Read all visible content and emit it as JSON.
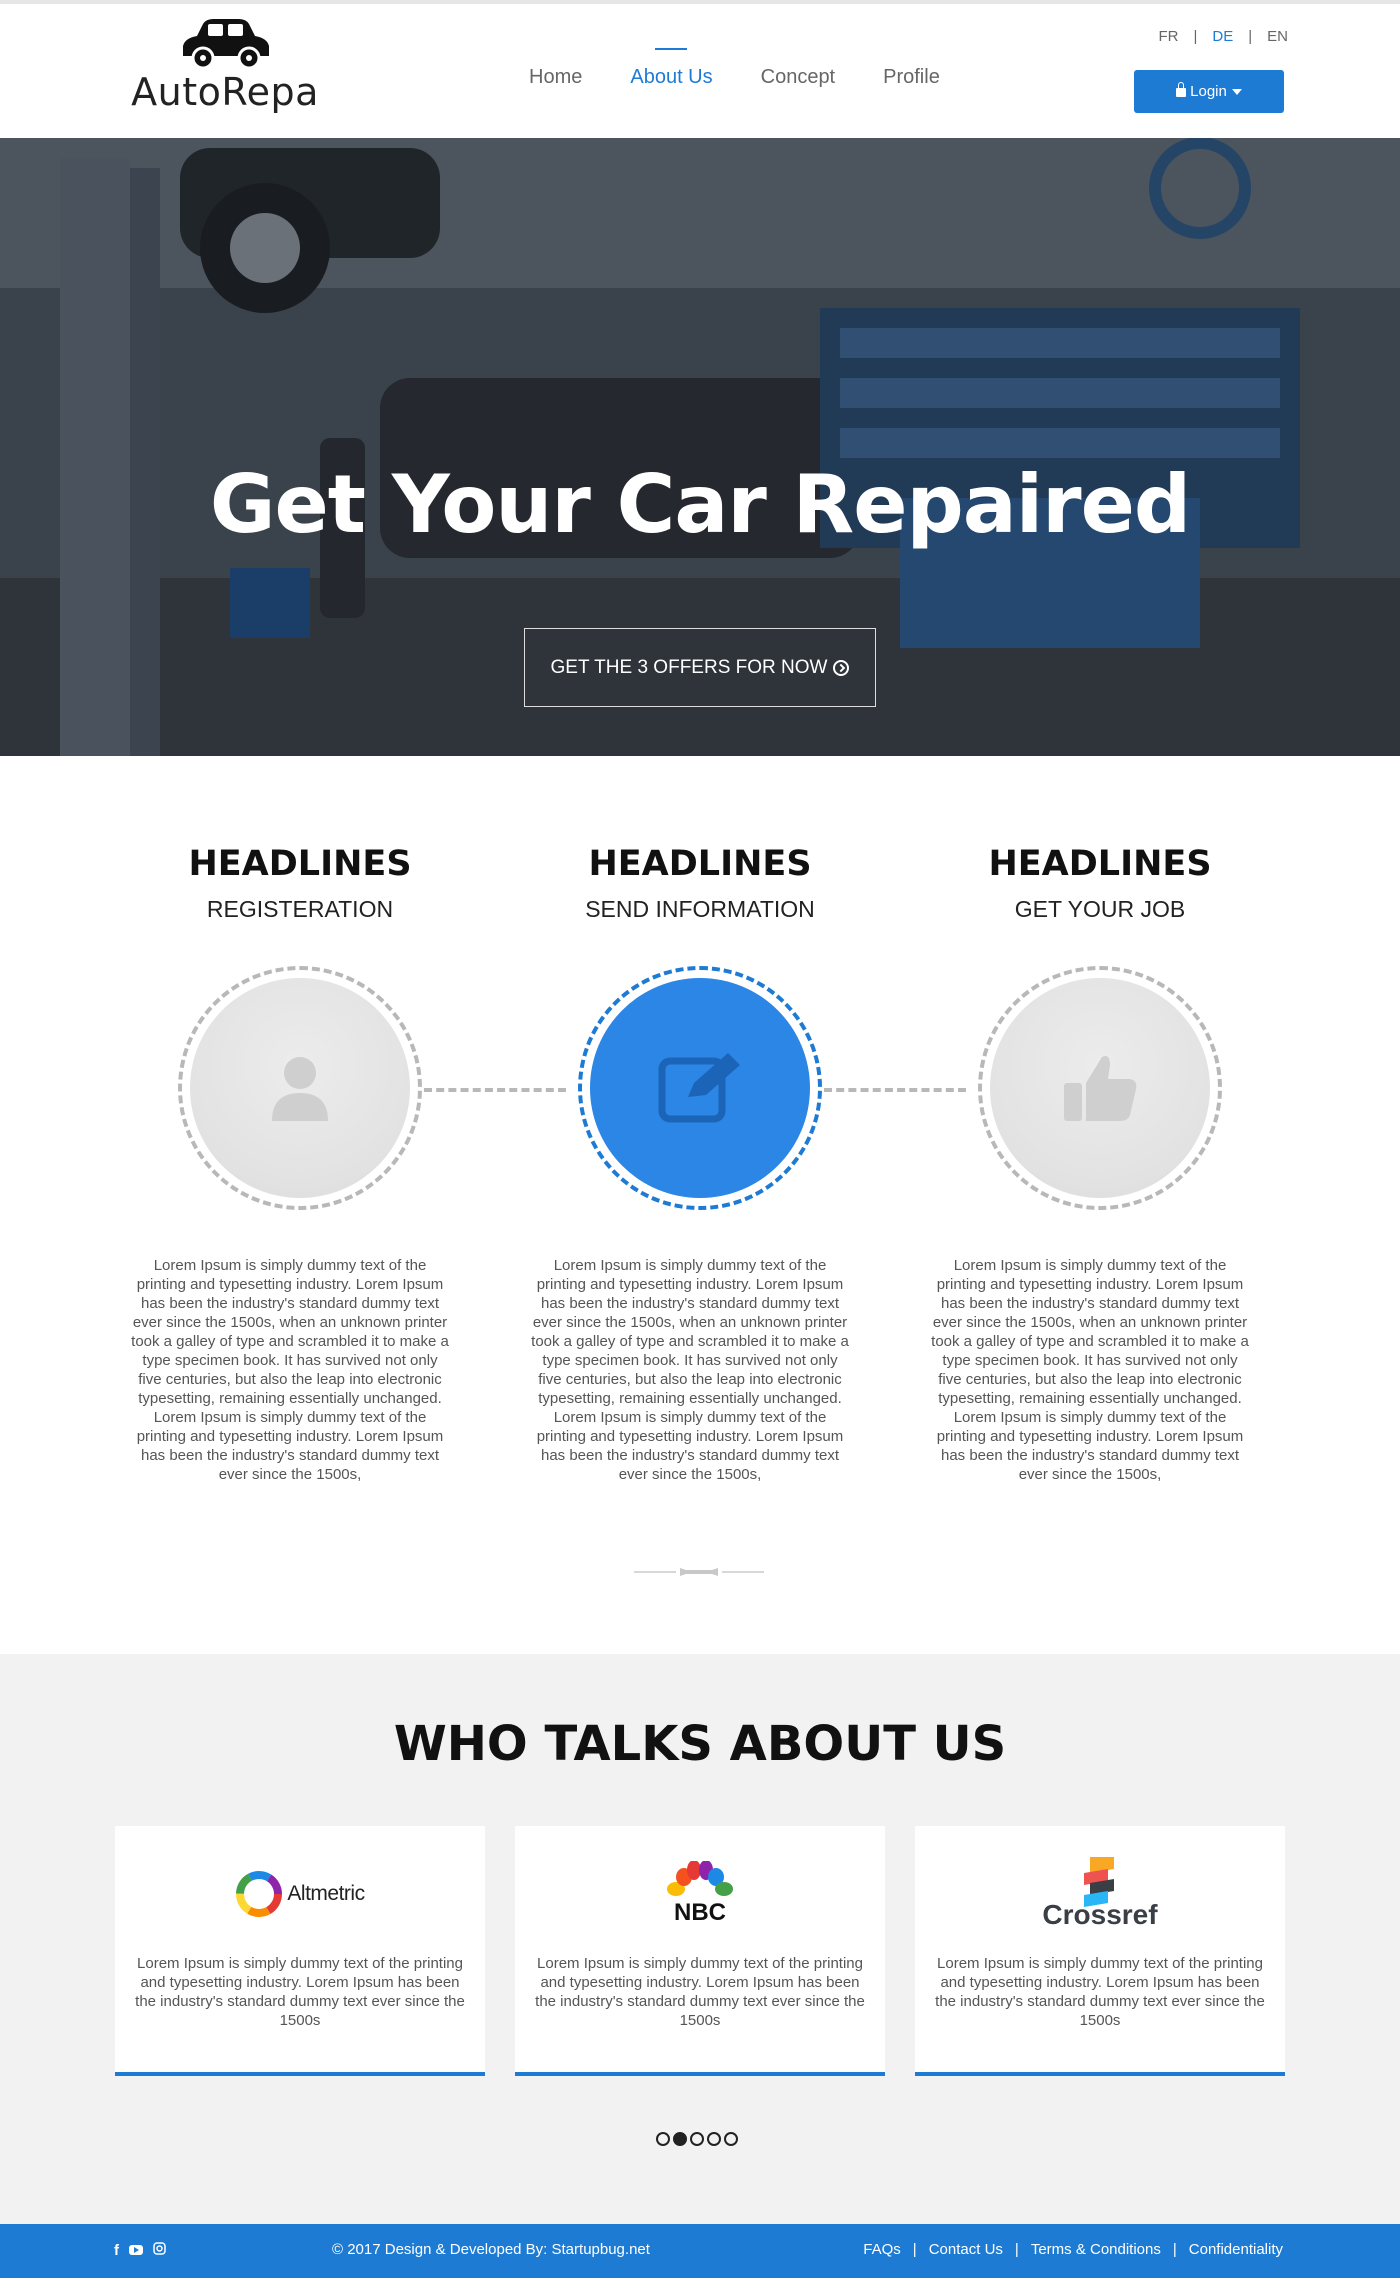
{
  "header": {
    "logo_text": "AutoRepa",
    "nav": [
      "Home",
      "About Us",
      "Concept",
      "Profile"
    ],
    "nav_active": "About Us",
    "languages": [
      "FR",
      "DE",
      "EN"
    ],
    "language_active": "DE",
    "login_label": "Login"
  },
  "hero": {
    "title": "Get Your Car Repaired",
    "button_label": "GET THE 3 OFFERS FOR NOW"
  },
  "steps": [
    {
      "title": "HEADLINES",
      "subtitle": "REGISTERATION",
      "icon": "user-icon",
      "text": "Lorem Ipsum is simply dummy text of the printing and typesetting industry. Lorem Ipsum has been the industry's standard dummy text ever since the 1500s, when an unknown printer took a galley of type and scrambled it to make a type specimen book. It has survived not only five centuries, but also the leap into electronic typesetting, remaining essentially unchanged. Lorem Ipsum is simply dummy text of the printing and typesetting industry. Lorem Ipsum has been the industry's standard dummy text ever since the 1500s,"
    },
    {
      "title": "HEADLINES",
      "subtitle": "SEND INFORMATION",
      "icon": "edit-icon",
      "text": "Lorem Ipsum is simply dummy text of the printing and typesetting industry. Lorem Ipsum has been the industry's standard dummy text ever since the 1500s, when an unknown printer took a galley of type and scrambled it to make a type specimen book. It has survived not only five centuries, but also the leap into electronic typesetting, remaining essentially unchanged. Lorem Ipsum is simply dummy text of the printing and typesetting industry. Lorem Ipsum has been the industry's standard dummy text ever since the 1500s,"
    },
    {
      "title": "HEADLINES",
      "subtitle": "GET YOUR JOB",
      "icon": "thumbs-up-icon",
      "text": "Lorem Ipsum is simply dummy text of the printing and typesetting industry. Lorem Ipsum has been the industry's standard dummy text ever since the 1500s, when an unknown printer took a galley of type and scrambled it to make a type specimen book. It has survived not only five centuries, but also the leap into electronic typesetting, remaining essentially unchanged. Lorem Ipsum is simply dummy text of the printing and typesetting industry. Lorem Ipsum has been the industry's standard dummy text ever since the 1500s,"
    }
  ],
  "talks": {
    "title": "WHO TALKS ABOUT US",
    "cards": [
      {
        "brand": "Altmetric",
        "text": "Lorem Ipsum is simply dummy text of the printing and typesetting industry. Lorem Ipsum has been the industry's standard dummy text ever since the 1500s"
      },
      {
        "brand": "NBC",
        "text": "Lorem Ipsum is simply dummy text of the printing and typesetting industry. Lorem Ipsum has been the industry's standard dummy text ever since the 1500s"
      },
      {
        "brand": "Crossref",
        "text": "Lorem Ipsum is simply dummy text of the printing and typesetting industry. Lorem Ipsum has been the industry's standard dummy text ever since the 1500s"
      }
    ],
    "carousel_pages": 5,
    "carousel_active": 2
  },
  "footer": {
    "social_icons": [
      "facebook-icon",
      "youtube-icon",
      "instagram-icon"
    ],
    "copyright": "© 2017 Design & Developed By: Startupbug.net",
    "links": [
      "FAQs",
      "Contact Us",
      "Terms & Conditions",
      "Confidentiality"
    ]
  },
  "colors": {
    "accent": "#1e7bd4",
    "footer_bg": "#1e7bd4",
    "section_bg": "#f2f2f2"
  }
}
